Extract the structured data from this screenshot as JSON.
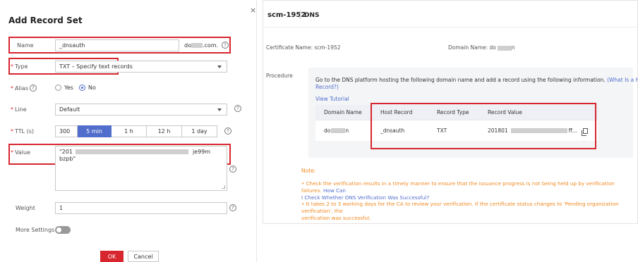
{
  "dialog": {
    "title": "Add Record Set",
    "close_glyph": "×",
    "name": {
      "label": "Name",
      "value": "_dnsauth",
      "suffix_start": "do",
      "suffix_end": ".com."
    },
    "type": {
      "label": "Type",
      "value": "TXT – Specify text records"
    },
    "alias": {
      "label": "Alias",
      "yes": "Yes",
      "no": "No",
      "selected": "No"
    },
    "line": {
      "label": "Line",
      "value": "Default"
    },
    "ttl": {
      "label": "TTL (s)",
      "value": "300",
      "options": [
        "5 min",
        "1 h",
        "12 h",
        "1 day"
      ],
      "selected": "5 min"
    },
    "value": {
      "label": "Value",
      "line1_start": "\"201",
      "line1_end": "je99m",
      "line2": "bzpb\""
    },
    "weight": {
      "label": "Weight",
      "value": "1"
    },
    "more_settings": {
      "label": "More Settings"
    },
    "ok_label": "OK",
    "cancel_label": "Cancel",
    "help_glyph": "?"
  },
  "right": {
    "cert_name": "scm-1952",
    "section": "DNS",
    "cert_name_label": "Certificate Name: scm-1952",
    "domain_name_label": "Domain Name: do",
    "domain_name_end": "n",
    "procedure_label": "Procedure",
    "instruction": "Go to the DNS platform hosting the following domain name and add a record using the following information.",
    "instruction_link_1": "(What Is a Host",
    "instruction_link_2": "Record?)",
    "instruction_line1": "Go to the DNS platform hosting the following domain name and add a record using the following information.",
    "view_tutorial": "View Tutorial",
    "table": {
      "headers": [
        "Domain Name",
        "Host Record",
        "Record Type",
        "Record Value"
      ],
      "row": {
        "domain_start": "do",
        "domain_end": "n",
        "host": "_dnsauth",
        "type": "TXT",
        "value_start": "201801",
        "value_end": "ff..."
      }
    },
    "note_title": "Note:",
    "note_1a": "• Check the verification results in a timely manner to ensure that the issuance progress is not being held up by verification failures.",
    "note_1_link_a": "How Can",
    "note_1_link_b": "I Check Whether DNS Verification Was Successful?",
    "note_2a": "• It takes 2 to 3 working days for the CA to review your verification. If the certificate status changes to 'Pending organization verification', the",
    "note_2b": "verification was successful."
  },
  "colors": {
    "accent": "#526ecc",
    "danger": "#d7262e",
    "note": "#f08a24"
  }
}
